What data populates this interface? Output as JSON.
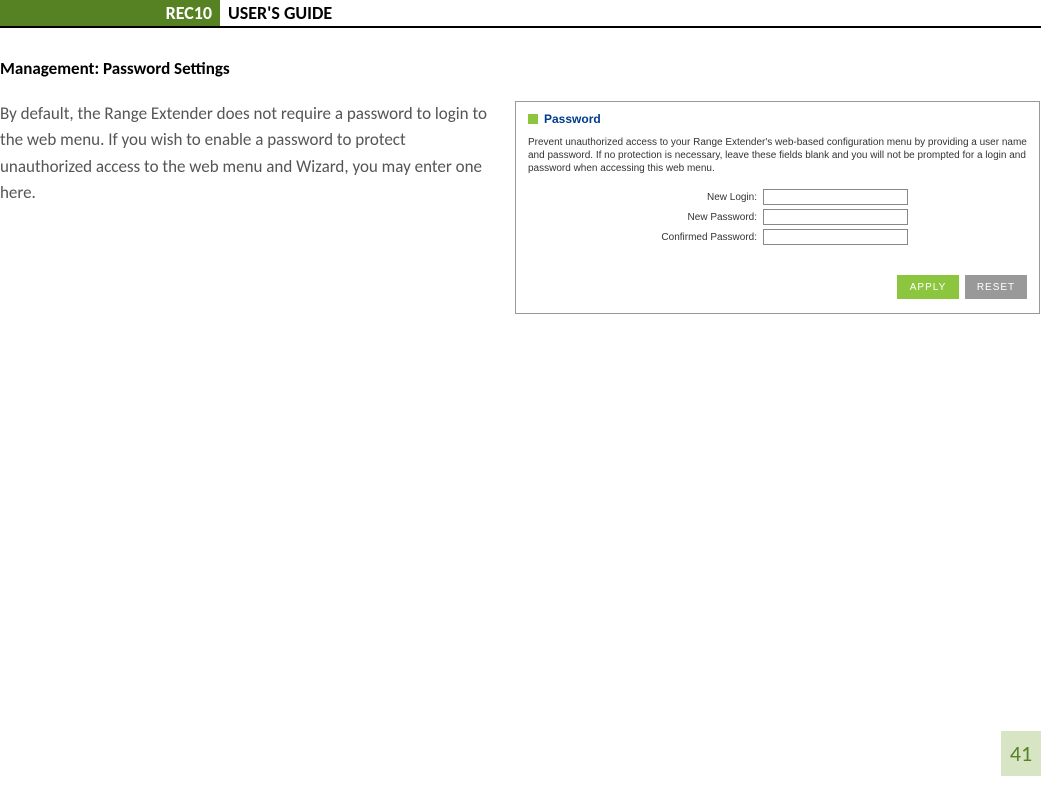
{
  "header": {
    "left": "REC10",
    "right": "USER'S GUIDE"
  },
  "section_title": "Management: Password Settings",
  "body_text": "By default, the Range Extender does not require a password to login to the web menu.  If you wish to enable a password to protect unauthorized access to the web menu and Wizard, you may enter one here.",
  "panel": {
    "title": "Password",
    "description": "Prevent unauthorized access to your Range Extender's web-based configuration menu by providing a user name and password. If no protection is necessary, leave these fields blank and you will not be prompted for a login and password when accessing this web menu.",
    "fields": {
      "new_login_label": "New Login:",
      "new_login_value": "",
      "new_password_label": "New Password:",
      "new_password_value": "",
      "confirmed_password_label": "Confirmed Password:",
      "confirmed_password_value": ""
    },
    "buttons": {
      "apply": "APPLY",
      "reset": "RESET"
    }
  },
  "page_number": "41"
}
